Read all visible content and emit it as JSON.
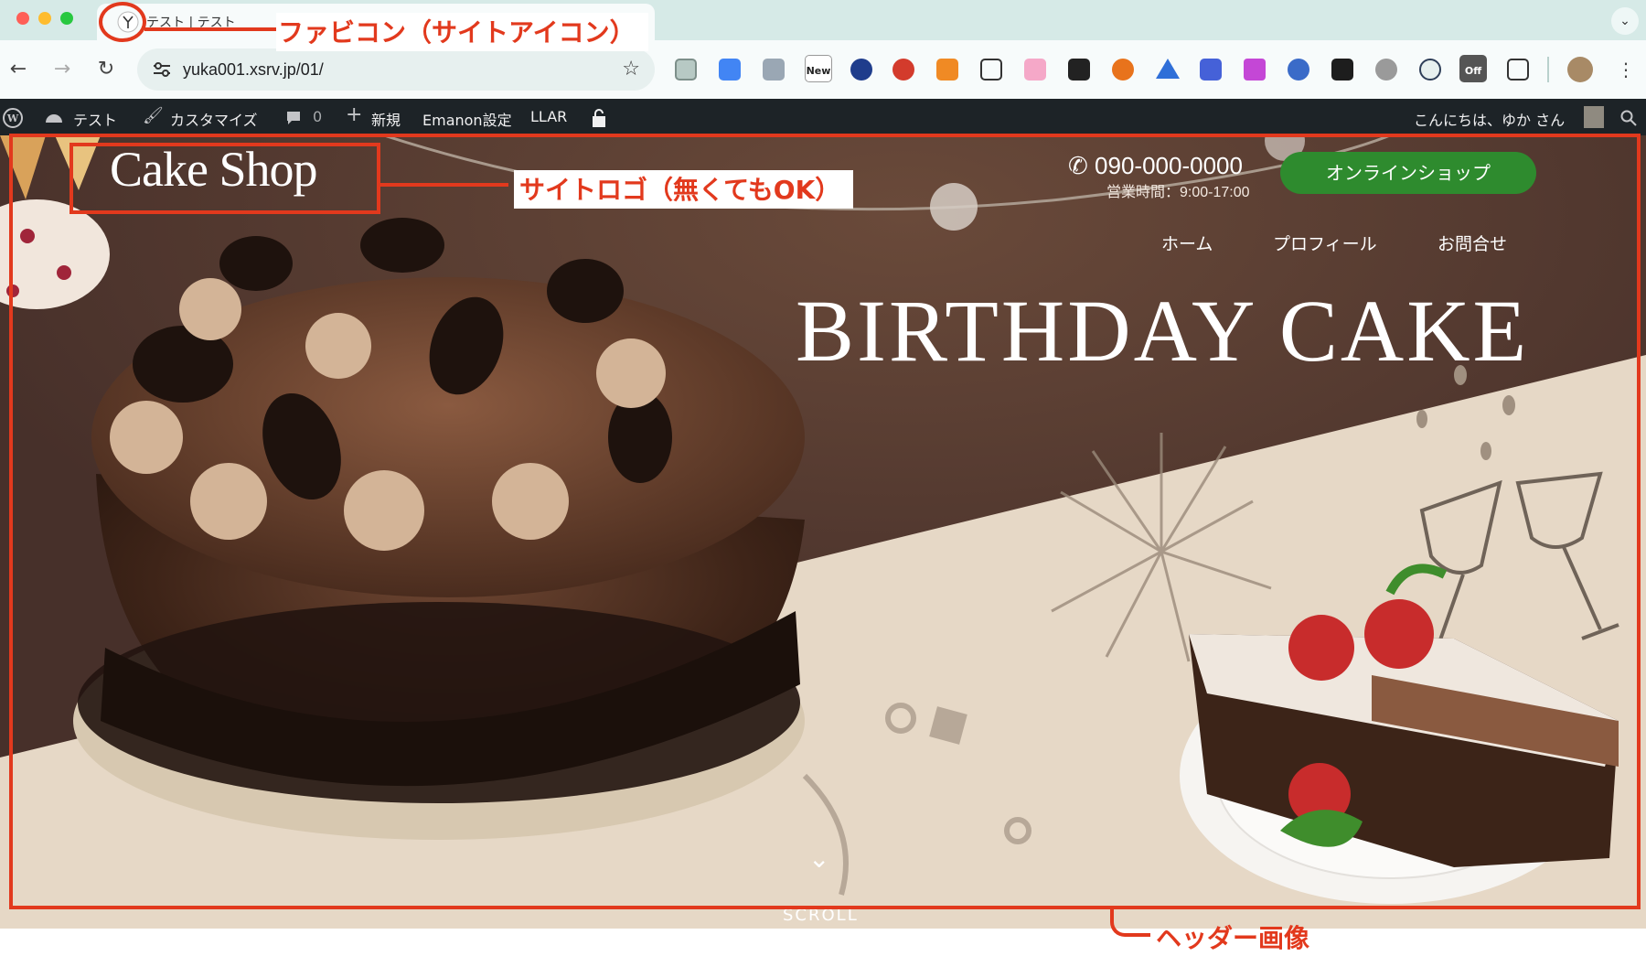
{
  "browser": {
    "tab_title": "テスト | テスト",
    "url": "yuka001.xsrv.jp/01/",
    "extension_badges": [
      "New",
      "Off"
    ]
  },
  "admin_bar": {
    "site_name": "テスト",
    "customize": "カスタマイズ",
    "comments_count": "0",
    "new": "新規",
    "emanon_settings": "Emanon設定",
    "llar": "LLAR",
    "greeting": "こんにちは、ゆか さん"
  },
  "site": {
    "logo": "Cake Shop",
    "phone": "090-000-0000",
    "hours": "営業時間：9:00-17:00",
    "shop_button": "オンラインショップ",
    "nav": [
      "ホーム",
      "プロフィール",
      "お問合せ"
    ],
    "headline": "BIRTHDAY CAKE",
    "scroll_label": "SCROLL"
  },
  "annotations": {
    "favicon": "ファビコン（サイトアイコン）",
    "site_logo": "サイトロゴ（無くてもOK）",
    "header_image": "ヘッダー画像"
  },
  "colors": {
    "annotation_red": "#e2391d",
    "shop_button_green": "#2e8b2e",
    "hero_brown": "#4a3128",
    "hero_cream": "#e6d8c6",
    "admin_bar": "#1d2327"
  }
}
